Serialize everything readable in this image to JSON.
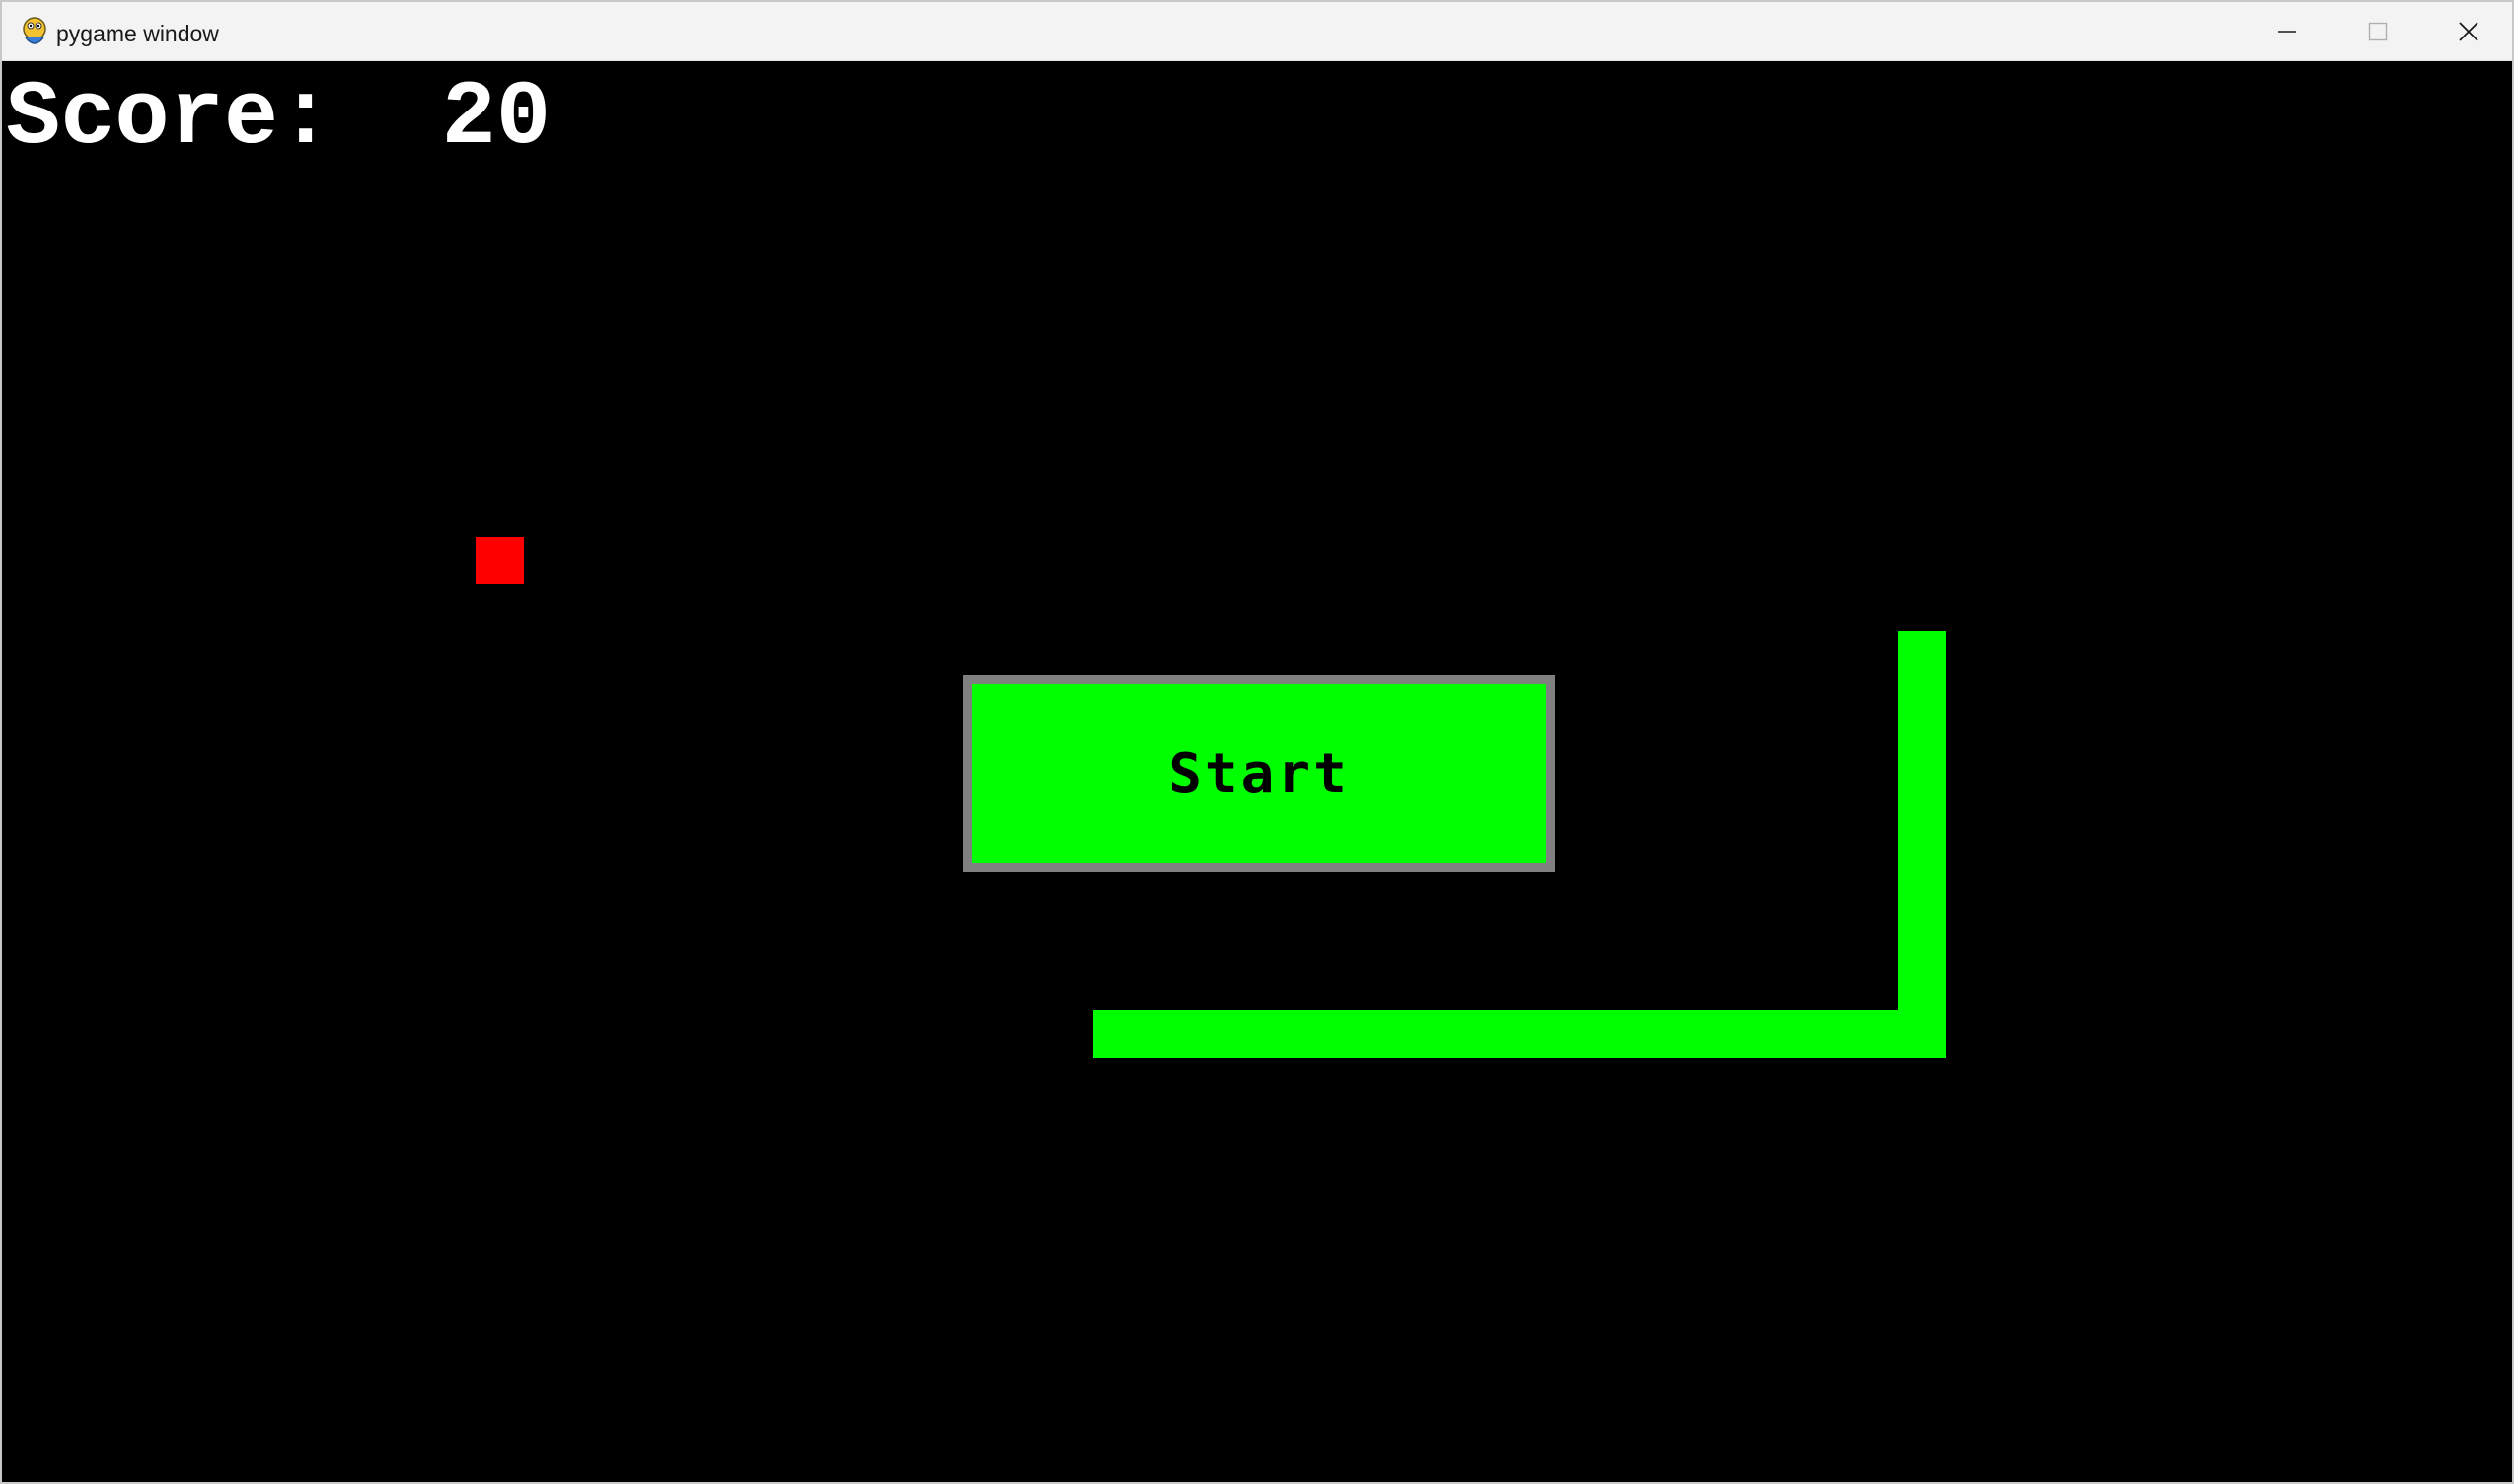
{
  "window": {
    "title": "pygame window",
    "icon": "pygame-snake-icon",
    "controls": [
      "minimize-icon",
      "maximize-icon",
      "close-icon"
    ]
  },
  "game": {
    "score_label": "Score:  20",
    "score": 20,
    "start_button_label": "Start",
    "colors": {
      "background": "#000000",
      "snake": "#00ff00",
      "food": "#ff0000",
      "button_fill": "#00ff00",
      "button_border": "#808080",
      "score_text": "#ffffff"
    }
  }
}
